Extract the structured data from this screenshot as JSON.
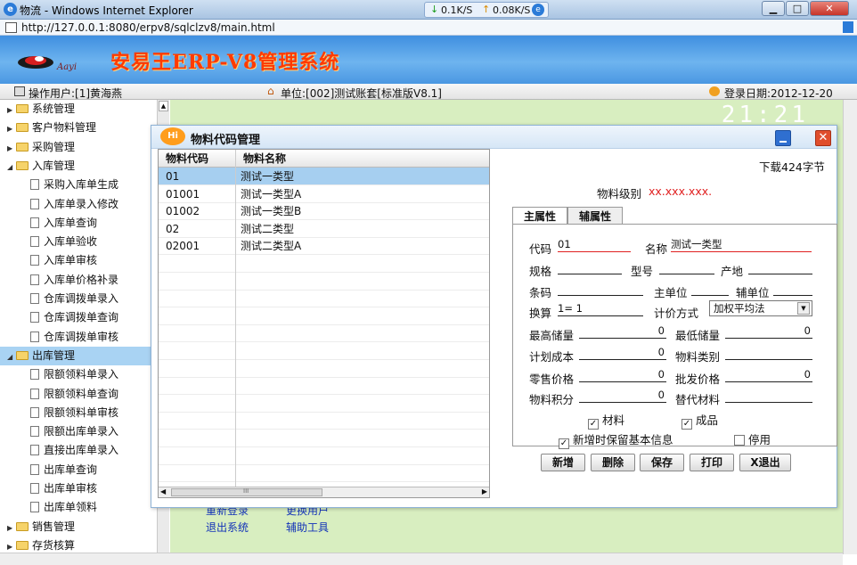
{
  "browser": {
    "title": "物流 - Windows Internet Explorer",
    "url": "http://127.0.0.1:8080/erpv8/sqlclzv8/main.html",
    "net_down": "0.1K/S",
    "net_up": "0.08K/S"
  },
  "app": {
    "logo_text": "Aayi",
    "title": "安易王ERP-V8管理系统",
    "operator": "操作用户:[1]黄海燕",
    "unit": "单位:[002]测试账套[标准版V8.1]",
    "login_date": "登录日期:2012-12-20",
    "clock": "21:21"
  },
  "sidebar": {
    "items": [
      {
        "label": "系统管理",
        "type": "folder"
      },
      {
        "label": "客户物料管理",
        "type": "folder"
      },
      {
        "label": "采购管理",
        "type": "folder"
      },
      {
        "label": "入库管理",
        "type": "folder-open"
      },
      {
        "label": "采购入库单生成",
        "type": "doc"
      },
      {
        "label": "入库单录入修改",
        "type": "doc"
      },
      {
        "label": "入库单查询",
        "type": "doc"
      },
      {
        "label": "入库单验收",
        "type": "doc"
      },
      {
        "label": "入库单审核",
        "type": "doc"
      },
      {
        "label": "入库单价格补录",
        "type": "doc"
      },
      {
        "label": "仓库调拨单录入",
        "type": "doc"
      },
      {
        "label": "仓库调拨单查询",
        "type": "doc"
      },
      {
        "label": "仓库调拨单审核",
        "type": "doc"
      },
      {
        "label": "出库管理",
        "type": "folder-open"
      },
      {
        "label": "限额领料单录入",
        "type": "doc"
      },
      {
        "label": "限额领料单查询",
        "type": "doc"
      },
      {
        "label": "限额领料单审核",
        "type": "doc"
      },
      {
        "label": "限额出库单录入",
        "type": "doc"
      },
      {
        "label": "直接出库单录入",
        "type": "doc"
      },
      {
        "label": "出库单查询",
        "type": "doc"
      },
      {
        "label": "出库单审核",
        "type": "doc"
      },
      {
        "label": "出库单领料",
        "type": "doc"
      },
      {
        "label": "销售管理",
        "type": "folder"
      },
      {
        "label": "存货核算",
        "type": "folder"
      }
    ]
  },
  "main_links": {
    "relogin": "重新登录",
    "switch_user": "更换用户",
    "exit": "退出系统",
    "tools": "辅助工具"
  },
  "dialog": {
    "badge": "Hi",
    "title": "物料代码管理",
    "download": "下载424字节",
    "level_label": "物料级别",
    "level_value": "xx.xxx.xxx.",
    "grid": {
      "headers": [
        "物料代码",
        "物料名称"
      ],
      "rows": [
        [
          "01",
          "测试一类型"
        ],
        [
          "01001",
          "测试一类型A"
        ],
        [
          "01002",
          "测试一类型B"
        ],
        [
          "02",
          "测试二类型"
        ],
        [
          "02001",
          "测试二类型A"
        ]
      ],
      "scroll_grip": "III"
    },
    "tabs": [
      "主属性",
      "辅属性"
    ],
    "form": {
      "code_label": "代码",
      "code_value": "01",
      "name_label": "名称",
      "name_value": "测试一类型",
      "spec_label": "规格",
      "model_label": "型号",
      "origin_label": "产地",
      "barcode_label": "条码",
      "main_unit_label": "主单位",
      "aux_unit_label": "辅单位",
      "convert_label": "换算",
      "convert_value": "1= 1",
      "pricing_label": "计价方式",
      "pricing_value": "加权平均法",
      "max_stock_label": "最高储量",
      "max_stock_value": "0",
      "min_stock_label": "最低储量",
      "min_stock_value": "0",
      "plan_cost_label": "计划成本",
      "plan_cost_value": "0",
      "category_label": "物料类别",
      "retail_label": "零售价格",
      "retail_value": "0",
      "wholesale_label": "批发价格",
      "wholesale_value": "0",
      "points_label": "物料积分",
      "points_value": "0",
      "substitute_label": "替代材料",
      "material_label": "材料",
      "product_label": "成品",
      "keep_info_label": "新增时保留基本信息",
      "disabled_label": "停用"
    },
    "buttons": {
      "add": "新增",
      "delete": "删除",
      "save": "保存",
      "print": "打印",
      "exit": "X退出"
    }
  }
}
